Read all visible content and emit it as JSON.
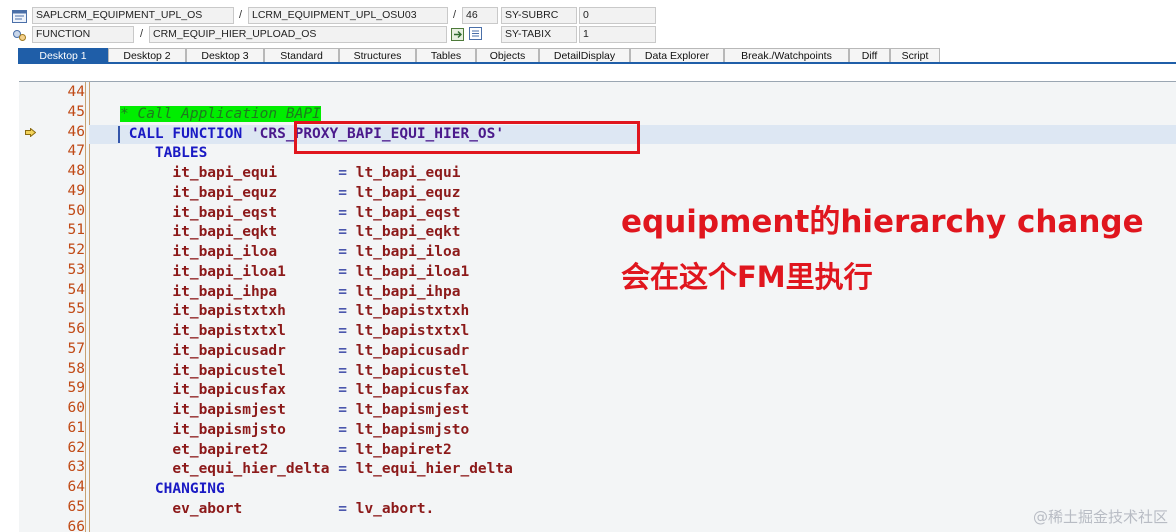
{
  "header": {
    "row1": {
      "program": "SAPLCRM_EQUIPMENT_UPL_OS",
      "include": "LCRM_EQUIPMENT_UPL_OSU03",
      "line": "46",
      "field": "SY-SUBRC",
      "value": "0"
    },
    "row2": {
      "type": "FUNCTION",
      "name": "CRM_EQUIP_HIER_UPLOAD_OS",
      "field": "SY-TABIX",
      "value": "1"
    },
    "slash": "/"
  },
  "tabs": [
    {
      "label": "Desktop 1",
      "active": true
    },
    {
      "label": "Desktop 2",
      "active": false
    },
    {
      "label": "Desktop 3",
      "active": false
    },
    {
      "label": "Standard",
      "active": false
    },
    {
      "label": "Structures",
      "active": false
    },
    {
      "label": "Tables",
      "active": false
    },
    {
      "label": "Objects",
      "active": false
    },
    {
      "label": "DetailDisplay",
      "active": false
    },
    {
      "label": "Data Explorer",
      "active": false
    },
    {
      "label": "Break./Watchpoints",
      "active": false
    },
    {
      "label": "Diff",
      "active": false
    },
    {
      "label": "Script",
      "active": false
    }
  ],
  "code": {
    "current_line": "46",
    "lines": [
      {
        "no": "44",
        "parts": []
      },
      {
        "no": "45",
        "parts": [
          {
            "t": "* Call Application BAPI",
            "c": "cmt"
          }
        ]
      },
      {
        "no": "46",
        "parts": [
          {
            "t": " CALL FUNCTION ",
            "c": "kw"
          },
          {
            "t": "'CRS_PROXY_BAPI_EQUI_HIER_OS'",
            "c": "str"
          }
        ]
      },
      {
        "no": "47",
        "parts": [
          {
            "t": "    TABLES",
            "c": "kw"
          }
        ]
      },
      {
        "no": "48",
        "parts": [
          {
            "t": "      it_bapi_equi       ",
            "c": "var"
          },
          {
            "t": "= ",
            "c": "eq"
          },
          {
            "t": "lt_bapi_equi",
            "c": "var"
          }
        ]
      },
      {
        "no": "49",
        "parts": [
          {
            "t": "      it_bapi_equz       ",
            "c": "var"
          },
          {
            "t": "= ",
            "c": "eq"
          },
          {
            "t": "lt_bapi_equz",
            "c": "var"
          }
        ]
      },
      {
        "no": "50",
        "parts": [
          {
            "t": "      it_bapi_eqst       ",
            "c": "var"
          },
          {
            "t": "= ",
            "c": "eq"
          },
          {
            "t": "lt_bapi_eqst",
            "c": "var"
          }
        ]
      },
      {
        "no": "51",
        "parts": [
          {
            "t": "      it_bapi_eqkt       ",
            "c": "var"
          },
          {
            "t": "= ",
            "c": "eq"
          },
          {
            "t": "lt_bapi_eqkt",
            "c": "var"
          }
        ]
      },
      {
        "no": "52",
        "parts": [
          {
            "t": "      it_bapi_iloa       ",
            "c": "var"
          },
          {
            "t": "= ",
            "c": "eq"
          },
          {
            "t": "lt_bapi_iloa",
            "c": "var"
          }
        ]
      },
      {
        "no": "53",
        "parts": [
          {
            "t": "      it_bapi_iloa1      ",
            "c": "var"
          },
          {
            "t": "= ",
            "c": "eq"
          },
          {
            "t": "lt_bapi_iloa1",
            "c": "var"
          }
        ]
      },
      {
        "no": "54",
        "parts": [
          {
            "t": "      it_bapi_ihpa       ",
            "c": "var"
          },
          {
            "t": "= ",
            "c": "eq"
          },
          {
            "t": "lt_bapi_ihpa",
            "c": "var"
          }
        ]
      },
      {
        "no": "55",
        "parts": [
          {
            "t": "      it_bapistxtxh      ",
            "c": "var"
          },
          {
            "t": "= ",
            "c": "eq"
          },
          {
            "t": "lt_bapistxtxh",
            "c": "var"
          }
        ]
      },
      {
        "no": "56",
        "parts": [
          {
            "t": "      it_bapistxtxl      ",
            "c": "var"
          },
          {
            "t": "= ",
            "c": "eq"
          },
          {
            "t": "lt_bapistxtxl",
            "c": "var"
          }
        ]
      },
      {
        "no": "57",
        "parts": [
          {
            "t": "      it_bapicusadr      ",
            "c": "var"
          },
          {
            "t": "= ",
            "c": "eq"
          },
          {
            "t": "lt_bapicusadr",
            "c": "var"
          }
        ]
      },
      {
        "no": "58",
        "parts": [
          {
            "t": "      it_bapicustel      ",
            "c": "var"
          },
          {
            "t": "= ",
            "c": "eq"
          },
          {
            "t": "lt_bapicustel",
            "c": "var"
          }
        ]
      },
      {
        "no": "59",
        "parts": [
          {
            "t": "      it_bapicusfax      ",
            "c": "var"
          },
          {
            "t": "= ",
            "c": "eq"
          },
          {
            "t": "lt_bapicusfax",
            "c": "var"
          }
        ]
      },
      {
        "no": "60",
        "parts": [
          {
            "t": "      it_bapismjest      ",
            "c": "var"
          },
          {
            "t": "= ",
            "c": "eq"
          },
          {
            "t": "lt_bapismjest",
            "c": "var"
          }
        ]
      },
      {
        "no": "61",
        "parts": [
          {
            "t": "      it_bapismjsto      ",
            "c": "var"
          },
          {
            "t": "= ",
            "c": "eq"
          },
          {
            "t": "lt_bapismjsto",
            "c": "var"
          }
        ]
      },
      {
        "no": "62",
        "parts": [
          {
            "t": "      et_bapiret2        ",
            "c": "var"
          },
          {
            "t": "= ",
            "c": "eq"
          },
          {
            "t": "lt_bapiret2",
            "c": "var"
          }
        ]
      },
      {
        "no": "63",
        "parts": [
          {
            "t": "      et_equi_hier_delta ",
            "c": "var"
          },
          {
            "t": "= ",
            "c": "eq"
          },
          {
            "t": "lt_equi_hier_delta",
            "c": "var"
          }
        ]
      },
      {
        "no": "64",
        "parts": [
          {
            "t": "    CHANGING",
            "c": "kw"
          }
        ]
      },
      {
        "no": "65",
        "parts": [
          {
            "t": "      ev_abort           ",
            "c": "var"
          },
          {
            "t": "= ",
            "c": "eq"
          },
          {
            "t": "lv_abort.",
            "c": "var"
          }
        ]
      },
      {
        "no": "66",
        "parts": []
      }
    ]
  },
  "annotation": {
    "line1": "equipment的hierarchy change",
    "line2": "会在这个FM里执行",
    "color": "#e0161e"
  },
  "watermark": "@稀土掘金技术社区"
}
